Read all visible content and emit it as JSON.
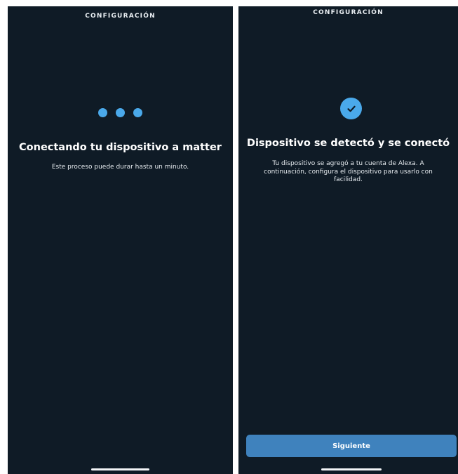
{
  "left_screen": {
    "header": "CONFIGURACIÓN",
    "title": "Conectando tu dispositivo a matter",
    "subtitle": "Este proceso puede durar hasta un minuto."
  },
  "right_screen": {
    "header": "CONFIGURACIÓN",
    "title": "Dispositivo se detectó y se conectó",
    "subtitle": "Tu dispositivo se agregó a tu cuenta de Alexa. A continuación, configura el dispositivo para usarlo con facilidad.",
    "button_label": "Siguiente"
  },
  "icons": {
    "loading": "loading-dots-icon",
    "success": "check-circle-icon"
  },
  "colors": {
    "background": "#0f1b26",
    "accent": "#4aa9ea",
    "button": "#3f82bd",
    "text": "#ffffff"
  }
}
